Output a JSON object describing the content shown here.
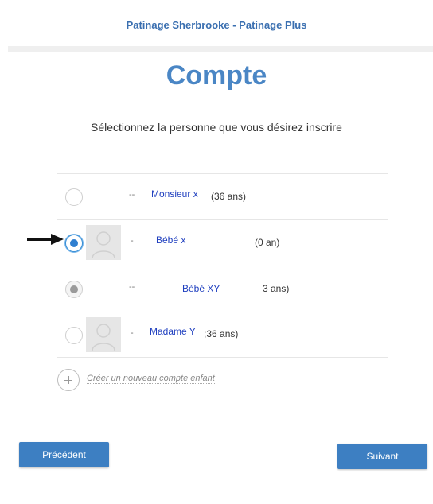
{
  "header": {
    "org_title": "Patinage Sherbrooke - Patinage Plus"
  },
  "page": {
    "title": "Compte",
    "subtitle": "Sélectionnez la personne que vous désirez inscrire"
  },
  "persons": [
    {
      "name": "Monsieur x",
      "dash": "--",
      "age": "(36 ans)",
      "state": "unchecked",
      "avatar": false
    },
    {
      "name": "Bébé x",
      "dash": "-",
      "age": "(0 an)",
      "state": "checked",
      "avatar": true
    },
    {
      "name": "Bébé XY",
      "dash": "--",
      "age": "3 ans)",
      "state": "disabled",
      "avatar": false
    },
    {
      "name": "Madame Y",
      "dash": "-",
      "age": ";36 ans)",
      "state": "unchecked",
      "avatar": true
    }
  ],
  "create_child_label": "Créer un nouveau compte enfant",
  "buttons": {
    "previous": "Précédent",
    "next": "Suivant"
  },
  "colors": {
    "accent": "#3d7fc2",
    "title": "#4a86c5",
    "name_link": "#1f3fbf"
  }
}
